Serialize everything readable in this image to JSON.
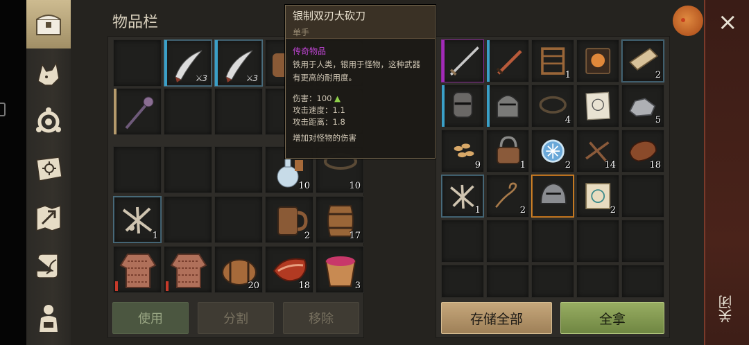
{
  "header": {
    "title": "物品栏"
  },
  "sidebar": {
    "items": [
      "chest-icon",
      "wolf-icon",
      "crafting-icon",
      "journal-icon",
      "map-icon",
      "quest-icon",
      "character-icon"
    ]
  },
  "inventory": {
    "slots": [
      {
        "name": "empty-slot"
      },
      {
        "name": "scimitar",
        "icon": "scimitar-icon",
        "damage": "3",
        "border": "blue"
      },
      {
        "name": "scimitar",
        "icon": "scimitar-icon",
        "damage": "3",
        "border": "blue"
      },
      {
        "name": "barrel-partial",
        "icon": "barrel-icon"
      },
      {
        "name": "spiked-mace",
        "icon": "mace-icon"
      },
      {
        "name": "barrel-count",
        "icon": "barrel-icon",
        "count": "20"
      },
      {
        "name": "meat",
        "icon": "meat-icon",
        "count": "18"
      },
      {
        "name": "berry-bucket",
        "icon": "bucket-icon",
        "count": "3"
      },
      {
        "name": "bones",
        "icon": "bones-icon",
        "count": "1"
      },
      {
        "name": "mug",
        "icon": "mug-icon",
        "count": "2"
      },
      {
        "name": "keg",
        "icon": "keg-icon",
        "count": "17"
      },
      {
        "name": "potion",
        "icon": "potion-icon",
        "count": "10"
      },
      {
        "name": "trap",
        "icon": "trap-icon",
        "count": "10"
      },
      {
        "name": "chainmail",
        "icon": "chainmail-icon"
      },
      {
        "name": "chainmail",
        "icon": "chainmail-icon"
      }
    ],
    "buttons": {
      "use": "使用",
      "split": "分割",
      "remove": "移除"
    }
  },
  "storage": {
    "slots": [
      {
        "icon": "sword-icon",
        "border": "purple"
      },
      {
        "icon": "dagger-icon"
      },
      {
        "icon": "crafting-rack-icon",
        "count": "1"
      },
      {
        "icon": "mask-book-icon"
      },
      {
        "icon": "planks-icon",
        "count": "2"
      },
      {
        "icon": "helmet-icon"
      },
      {
        "icon": "knight-helmet-icon"
      },
      {
        "icon": "trap-icon",
        "count": "4"
      },
      {
        "icon": "blueprint-icon"
      },
      {
        "icon": "ore-icon",
        "count": "5"
      },
      {
        "icon": "seeds-icon",
        "count": "9"
      },
      {
        "icon": "padlock-icon",
        "count": "1"
      },
      {
        "icon": "frost-orb-icon",
        "count": "2"
      },
      {
        "icon": "nails-icon",
        "count": "14"
      },
      {
        "icon": "leather-icon",
        "count": "18"
      },
      {
        "icon": "bones-icon",
        "count": "1"
      },
      {
        "icon": "rope-icon",
        "count": "2"
      },
      {
        "icon": "gladiator-helmet-icon",
        "border": "orange"
      },
      {
        "icon": "map-scroll-icon",
        "count": "2"
      }
    ],
    "buttons": {
      "store_all": "存储全部",
      "take_all": "全拿"
    }
  },
  "tooltip": {
    "name": "银制双刃大砍刀",
    "hand": "单手",
    "rarity": "传奇物品",
    "description": "铁用于人类，银用于怪物，这种武器有更高的耐用度。",
    "stats": [
      {
        "label": "伤害：",
        "value": "100"
      },
      {
        "label": "攻击速度：",
        "value": "1.1"
      },
      {
        "label": "攻击距离：",
        "value": "1.8"
      }
    ],
    "bonus": "增加对怪物的伤害"
  },
  "close": {
    "label": "关闭"
  },
  "colors": {
    "legendary": "#c045d4",
    "accent_green": "#98ad62",
    "accent_tan": "#c6a77b"
  }
}
